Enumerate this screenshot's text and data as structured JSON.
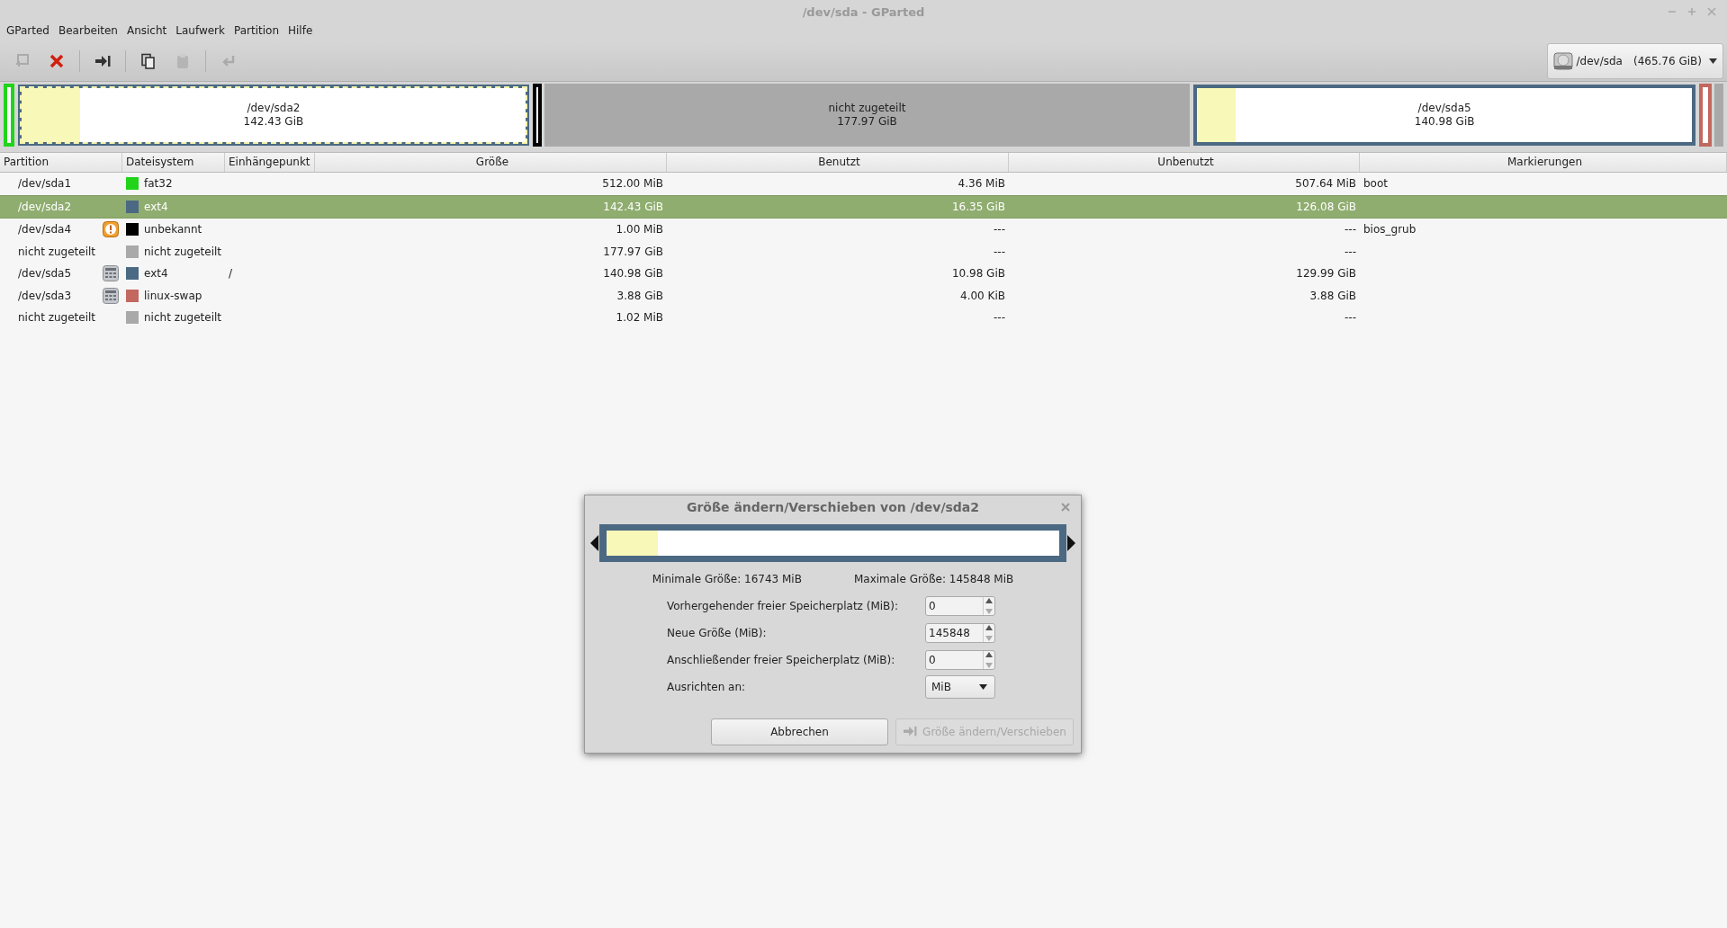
{
  "window": {
    "title": "/dev/sda - GParted"
  },
  "menu": [
    "GParted",
    "Bearbeiten",
    "Ansicht",
    "Laufwerk",
    "Partition",
    "Hilfe"
  ],
  "toolbar": [
    {
      "kind": "new",
      "disabled": true
    },
    {
      "kind": "delete",
      "disabled": false
    },
    {
      "kind": "sep"
    },
    {
      "kind": "resize",
      "disabled": false
    },
    {
      "kind": "sep"
    },
    {
      "kind": "copy",
      "disabled": false
    },
    {
      "kind": "paste",
      "disabled": true
    },
    {
      "kind": "sep"
    },
    {
      "kind": "undo",
      "disabled": true
    }
  ],
  "device": {
    "label": "/dev/sda",
    "size": "(465.76 GiB)"
  },
  "disk_map": [
    {
      "kind": "bar",
      "color": "#21d41a"
    },
    {
      "kind": "partition",
      "name": "/dev/sda2",
      "size": "142.43 GiB",
      "level": 0.116,
      "color": "#4b6983",
      "selected": true
    },
    {
      "kind": "bar",
      "color": "#000000"
    },
    {
      "kind": "unallocated",
      "name": "nicht zugeteilt",
      "size": "177.97 GiB",
      "selected": false
    },
    {
      "kind": "partition",
      "name": "/dev/sda5",
      "size": "140.98 GiB",
      "level": 0.078,
      "color": "#4b6983",
      "selected": false
    },
    {
      "kind": "bar",
      "color": "#c2685e"
    },
    {
      "kind": "filler"
    }
  ],
  "table": {
    "columns": [
      "Partition",
      "Dateisystem",
      "Einhängepunkt",
      "Größe",
      "Benutzt",
      "Unbenutzt",
      "Markierungen"
    ],
    "rows": [
      {
        "partition": "/dev/sda1",
        "kind": "plain",
        "filesystem": "fat32",
        "color": "#21d41a",
        "mount": "",
        "size": "512.00 MiB",
        "used": "4.36 MiB",
        "unused": "507.64 MiB",
        "flags": "boot",
        "selected": false
      },
      {
        "partition": "/dev/sda2",
        "kind": "plain",
        "filesystem": "ext4",
        "color": "#4b6983",
        "mount": "",
        "size": "142.43 GiB",
        "used": "16.35 GiB",
        "unused": "126.08 GiB",
        "flags": "",
        "selected": true
      },
      {
        "partition": "/dev/sda4",
        "kind": "warning",
        "filesystem": "unbekannt",
        "color": "#000000",
        "mount": "",
        "size": "1.00 MiB",
        "used": "---",
        "unused": "---",
        "flags": "bios_grub",
        "selected": false
      },
      {
        "partition": "nicht zugeteilt",
        "kind": "plain",
        "filesystem": "nicht zugeteilt",
        "color": "#a9a9a9",
        "mount": "",
        "size": "177.97 GiB",
        "used": "---",
        "unused": "---",
        "flags": "",
        "selected": false
      },
      {
        "partition": "/dev/sda5",
        "kind": "busy",
        "filesystem": "ext4",
        "color": "#4b6983",
        "mount": "/",
        "size": "140.98 GiB",
        "used": "10.98 GiB",
        "unused": "129.99 GiB",
        "flags": "",
        "selected": false
      },
      {
        "partition": "/dev/sda3",
        "kind": "busy",
        "filesystem": "linux-swap",
        "color": "#c2685e",
        "mount": "",
        "size": "3.88 GiB",
        "used": "4.00 KiB",
        "unused": "3.88 GiB",
        "flags": "",
        "selected": false
      },
      {
        "partition": "nicht zugeteilt",
        "kind": "plain",
        "filesystem": "nicht zugeteilt",
        "color": "#a9a9a9",
        "mount": "",
        "size": "1.02 MiB",
        "used": "---",
        "unused": "---",
        "flags": "",
        "selected": false
      }
    ]
  },
  "dialog": {
    "title": "Größe ändern/Verschieben von /dev/sda2",
    "level": 0.113,
    "min_size": "Minimale Größe: 16743 MiB",
    "max_size": "Maximale Größe: 145848 MiB",
    "fields": [
      {
        "kind": "spin",
        "label": "Vorhergehender freier Speicherplatz (MiB):",
        "value": "0"
      },
      {
        "kind": "spin",
        "label": "Neue Größe (MiB):",
        "value": "145848"
      },
      {
        "kind": "spin",
        "label": "Anschließender freier Speicherplatz (MiB):",
        "value": "0"
      },
      {
        "kind": "combo",
        "label": "Ausrichten an:",
        "value": "MiB"
      }
    ],
    "buttons": [
      {
        "label": "Abbrechen",
        "disabled": false,
        "kind": "cancel"
      },
      {
        "label": "Größe ändern/Verschieben",
        "disabled": true,
        "kind": "apply"
      }
    ]
  }
}
